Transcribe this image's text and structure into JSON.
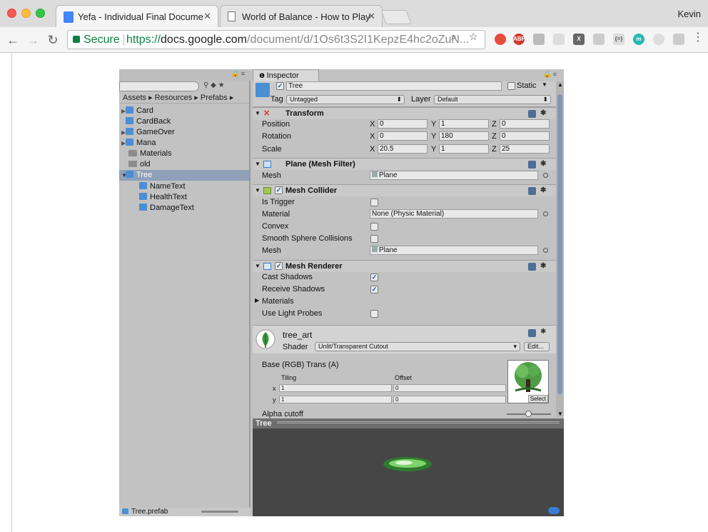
{
  "browser": {
    "tabs": [
      {
        "title": "Yefa - Individual Final Docume",
        "icon": "google-docs-icon"
      },
      {
        "title": "World of Balance - How to Play",
        "icon": "page-icon"
      }
    ],
    "user": "Kevin",
    "address": {
      "secure_label": "Secure",
      "scheme": "https://",
      "domain": "docs.google.com",
      "path": "/document/d/1Os6t3S2I1KepzE4hc2oZuN..."
    }
  },
  "project": {
    "breadcrumb": "Assets ▸ Resources ▸ Prefabs ▸",
    "items": [
      {
        "label": "Card",
        "type": "prefab",
        "expandable": true
      },
      {
        "label": "CardBack",
        "type": "prefab",
        "expandable": false
      },
      {
        "label": "GameOver",
        "type": "prefab",
        "expandable": true
      },
      {
        "label": "Mana",
        "type": "prefab",
        "expandable": true
      },
      {
        "label": "Materials",
        "type": "folder",
        "expandable": false
      },
      {
        "label": "old",
        "type": "folder",
        "expandable": false
      },
      {
        "label": "Tree",
        "type": "prefab",
        "expandable": true,
        "selected": true
      },
      {
        "label": "NameText",
        "type": "prefab",
        "child": true
      },
      {
        "label": "HealthText",
        "type": "prefab",
        "child": true
      },
      {
        "label": "DamageText",
        "type": "prefab",
        "child": true
      }
    ],
    "footer": "Tree.prefab"
  },
  "inspector": {
    "tab_label": "Inspector",
    "object_name": "Tree",
    "static_label": "Static",
    "tag_label": "Tag",
    "tag_value": "Untagged",
    "layer_label": "Layer",
    "layer_value": "Default",
    "transform": {
      "title": "Transform",
      "position_label": "Position",
      "rotation_label": "Rotation",
      "scale_label": "Scale",
      "axis_x": "X",
      "axis_y": "Y",
      "axis_z": "Z",
      "position": [
        "0",
        "1",
        "0"
      ],
      "rotation": [
        "0",
        "180",
        "0"
      ],
      "scale": [
        "20.5",
        "1",
        "25"
      ]
    },
    "mesh_filter": {
      "title": "Plane (Mesh Filter)",
      "mesh_label": "Mesh",
      "mesh_value": "Plane"
    },
    "mesh_collider": {
      "title": "Mesh Collider",
      "is_trigger_label": "Is Trigger",
      "material_label": "Material",
      "material_value": "None (Physic Material)",
      "convex_label": "Convex",
      "smooth_label": "Smooth Sphere Collisions",
      "mesh_label": "Mesh",
      "mesh_value": "Plane"
    },
    "mesh_renderer": {
      "title": "Mesh Renderer",
      "cast_label": "Cast Shadows",
      "receive_label": "Receive Shadows",
      "materials_label": "Materials",
      "probes_label": "Use Light Probes"
    },
    "material": {
      "name": "tree_art",
      "shader_label": "Shader",
      "shader_value": "Unlit/Transparent Cutout",
      "edit_label": "Edit...",
      "base_label": "Base (RGB) Trans (A)",
      "tiling_label": "Tiling",
      "offset_label": "Offset",
      "x_label": "x",
      "y_label": "y",
      "tiling_x": "1",
      "tiling_y": "1",
      "offset_x": "0",
      "offset_y": "0",
      "select_label": "Select",
      "alpha_label": "Alpha cutoff"
    },
    "preview_title": "Tree"
  },
  "colors": {
    "secure": "#0b8043",
    "selection": "#8fa0b8",
    "unity_bg": "#c2c2c2",
    "preview_bg": "#464646",
    "leaf_green": "#3f9a3f"
  }
}
